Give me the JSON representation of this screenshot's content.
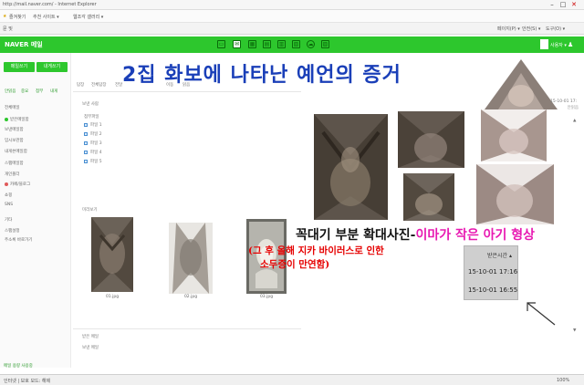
{
  "browser": {
    "title_text": "http://mail.naver.com/ - Internet Explorer",
    "favorites": [
      "즐겨찾기",
      "추천 사이트 ▾",
      "웹조각 갤러리 ▾"
    ],
    "cmd_left": "문 및",
    "cmd_right": [
      "페이지(P) ▾",
      "안전(S) ▾",
      "도구(O) ▾"
    ],
    "status_left": "인터넷 | 보호 모드: 해제",
    "status_mid": "",
    "zoom": "100%"
  },
  "naver": {
    "logo": "NAVER 메일",
    "user": "사용자 ▾"
  },
  "sidebar": {
    "write_label": "메일쓰기",
    "self_label": "내게쓰기",
    "quick": [
      "안읽음",
      "중요",
      "첨부",
      "내게"
    ],
    "items": [
      {
        "label": "전체메일",
        "count": "안읽음"
      },
      {
        "label": "받은메일함",
        "count": ""
      },
      {
        "label": "보낸메일함",
        "count": ""
      },
      {
        "label": "임시보관함",
        "count": ""
      },
      {
        "label": "내게쓴메일함",
        "count": ""
      },
      {
        "label": "스팸메일함",
        "count": ""
      },
      {
        "label": "휴지통",
        "count": ""
      }
    ],
    "folders": [
      {
        "label": "개인폴더",
        "count": ""
      },
      {
        "label": "카페/블로그",
        "count": ""
      },
      {
        "label": "쇼핑",
        "count": ""
      },
      {
        "label": "SNS",
        "count": ""
      },
      {
        "label": "기타",
        "count": ""
      }
    ],
    "bottom": [
      {
        "label": "스팸설정",
        "count": ""
      },
      {
        "label": "주소록 바로가기",
        "count": ""
      }
    ],
    "footer": "메일 용량 사용중"
  },
  "mail": {
    "toolbar": [
      "답장",
      "전체답장",
      "전달",
      "삭제",
      "스팸신고",
      "이동",
      "읽음"
    ],
    "from_label": "보낸 사람",
    "attach_label": "첨부파일",
    "files": [
      "파일 1",
      "파일 2",
      "파일 3",
      "파일 4",
      "파일 5"
    ],
    "thumb_label": "미리보기",
    "thumbs": [
      "01.jpg",
      "02.jpg",
      "03.jpg"
    ],
    "bottom_rows": [
      "받은 메일",
      "보낸 메일"
    ]
  },
  "overlay": {
    "headline": "2집 화보에 나타난 예언의 증거",
    "caption_black": "꼭대기 부분 확대사진-",
    "caption_pink": "이마가 작은 아기 형상",
    "caption_red_1": "(그 후 올해 지카 바이러스로 인한",
    "caption_red_2": "소두증이 만연함)"
  },
  "datebox": {
    "header": "받은시간 ▴",
    "dates": [
      "15-10-01 17:16",
      "15-10-01 16:55"
    ]
  },
  "right_panel": {
    "dates": [
      "15-10-01 17:"
    ],
    "icons": [
      "▲",
      "▼"
    ]
  },
  "icons": {
    "nav": [
      "mail-icon",
      "inbox-icon",
      "calendar-icon",
      "contacts-icon",
      "note-icon",
      "memo-icon",
      "cloud-icon",
      "drive-icon"
    ],
    "arrow": "annotation-arrow-icon"
  }
}
